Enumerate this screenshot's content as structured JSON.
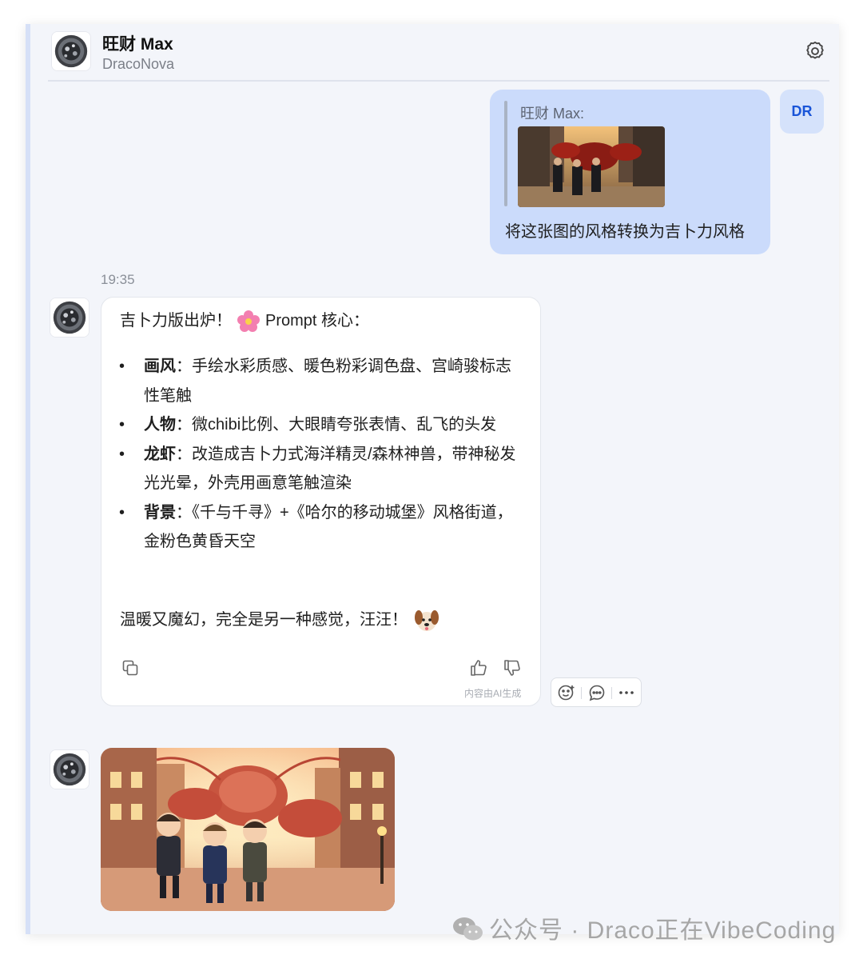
{
  "header": {
    "title": "旺财 Max",
    "subtitle": "DracoNova",
    "settings_icon": "gear-icon"
  },
  "user_message": {
    "quote_label": "旺财 Max:",
    "text": "将这张图的风格转换为吉卜力风格",
    "avatar_initials": "DR"
  },
  "timestamp": "19:35",
  "bot_message": {
    "intro": "吉卜力版出炉！",
    "intro_suffix": "Prompt 核心：",
    "bullets": [
      {
        "term": "画风",
        "text": "：手绘水彩质感、暖色粉彩调色盘、宫崎骏标志性笔触"
      },
      {
        "term": "人物",
        "text": "：微chibi比例、大眼睛夸张表情、乱飞的头发"
      },
      {
        "term": "龙虾",
        "text": "：改造成吉卜力式海洋精灵/森林神兽，带神秘发光光晕，外壳用画意笔触渲染"
      },
      {
        "term": "背景",
        "text": "：《千与千寻》+《哈尔的移动城堡》风格街道，金粉色黄昏天空"
      }
    ],
    "outro": "温暖又魔幻，完全是另一种感觉，汪汪！",
    "ai_note": "内容由AI生成",
    "icons": [
      "copy-icon",
      "thumbs-up-icon",
      "thumbs-down-icon"
    ]
  },
  "action_bar": {
    "icons": [
      "emoji-react-icon",
      "comment-icon",
      "more-icon"
    ]
  },
  "watermark": "公众号 · Draco正在VibeCoding",
  "colors": {
    "user_bubble": "#cbdbfb",
    "user_avatar_text": "#1a55d8",
    "frame_bg": "#f3f5fa"
  }
}
